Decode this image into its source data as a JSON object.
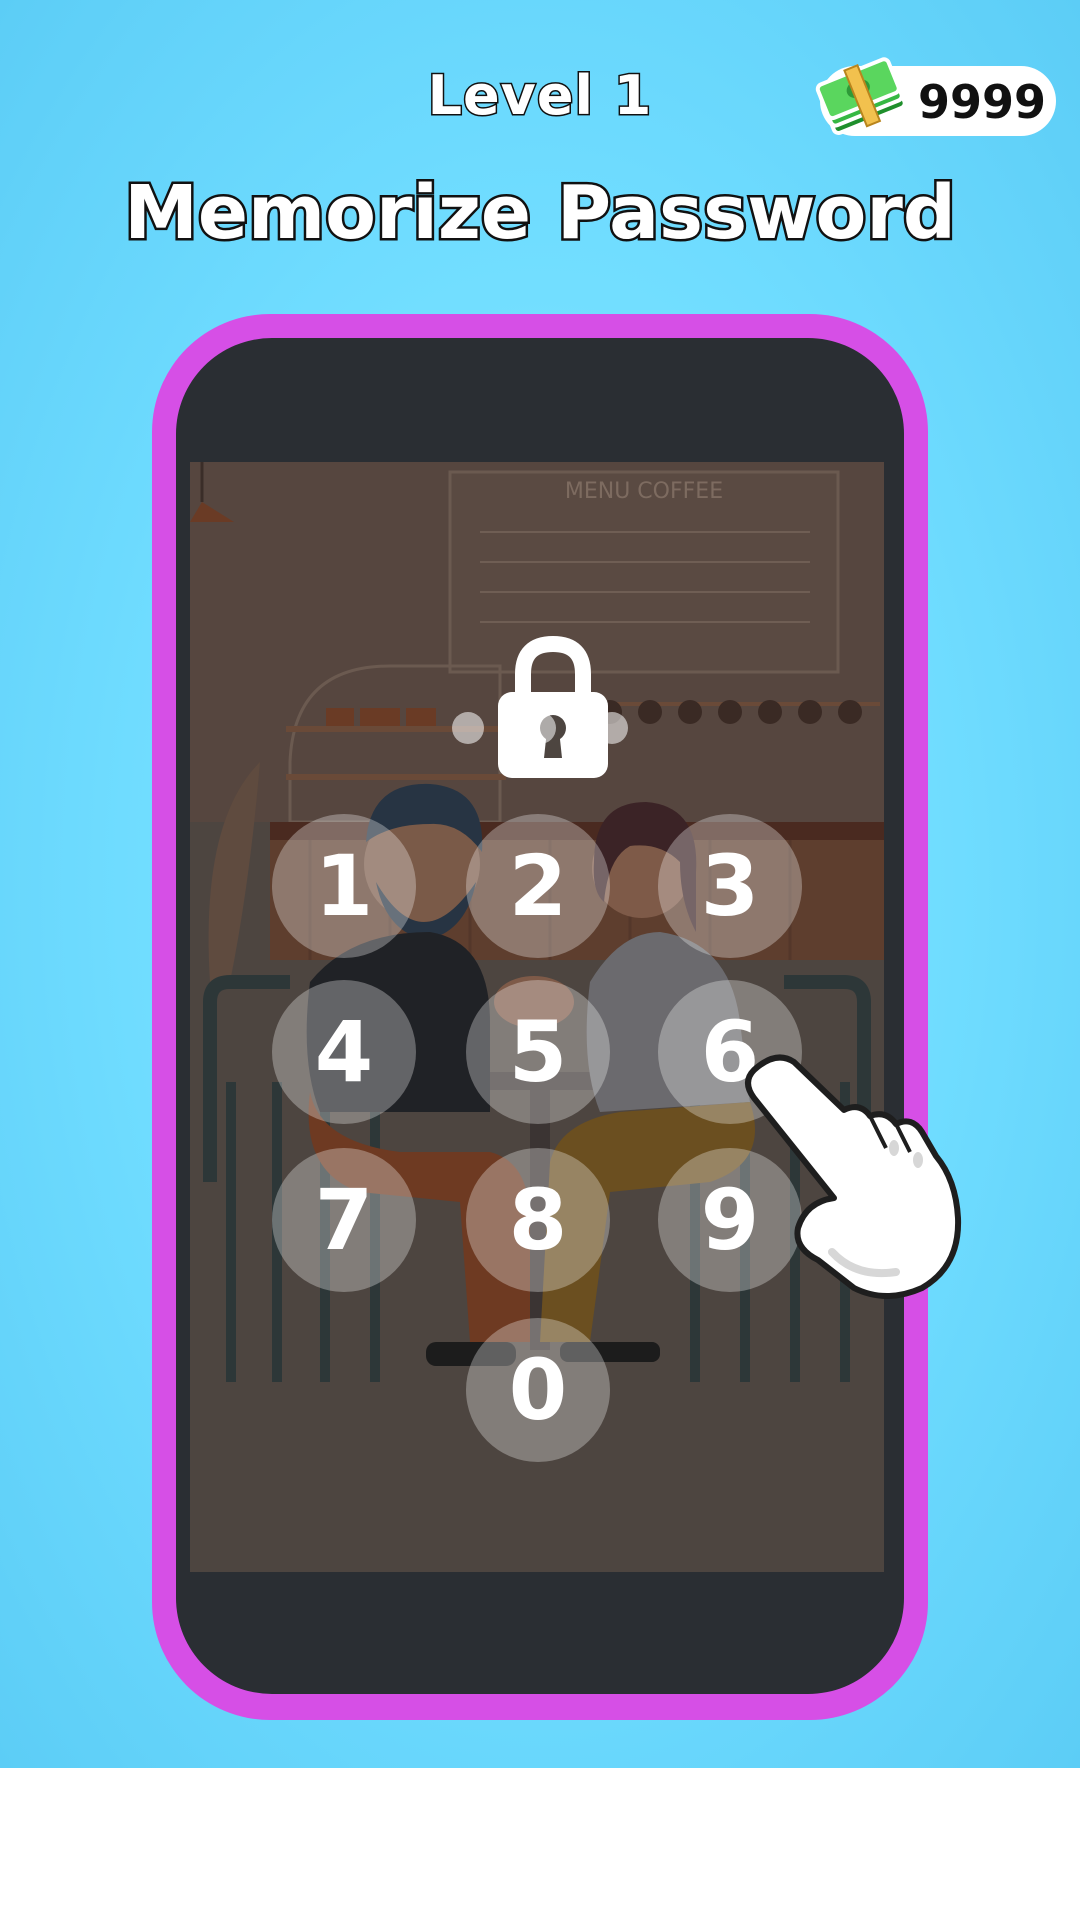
{
  "header": {
    "level_label": "Level 1",
    "coins": "9999",
    "instruction": "Memorize Password"
  },
  "screen": {
    "cafe_menu_sign": "MENU COFFEE",
    "password_dots": 3,
    "keypad": [
      "1",
      "2",
      "3",
      "4",
      "5",
      "6",
      "7",
      "8",
      "9",
      "0"
    ]
  },
  "icons": {
    "cash": "cash-stack-icon",
    "lock": "lock-icon",
    "hand": "pointing-hand-icon"
  },
  "colors": {
    "background": "#6fdcff",
    "phone_frame": "#d64fe6",
    "phone_body": "#2a2e33",
    "key": "rgba(255,255,255,0.30)"
  }
}
